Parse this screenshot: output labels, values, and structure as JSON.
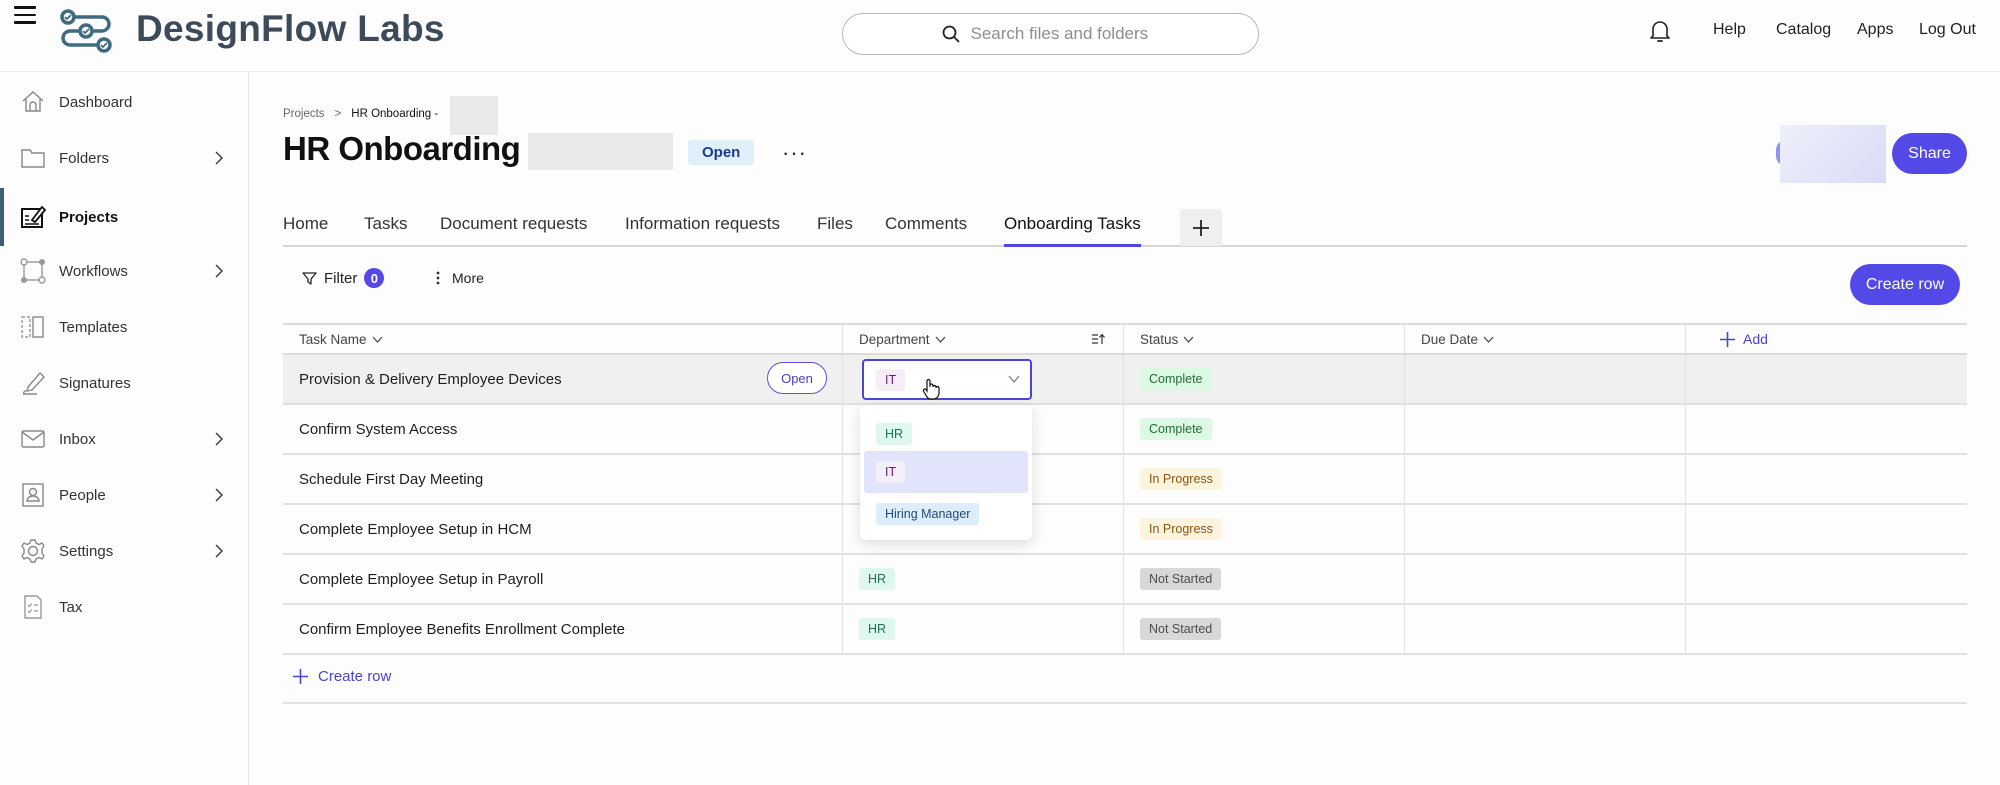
{
  "app": {
    "brand": "DesignFlow Labs",
    "search_placeholder": "Search files and folders",
    "top_links": [
      "Help",
      "Catalog",
      "Apps",
      "Log Out"
    ]
  },
  "sidebar": {
    "items": [
      {
        "label": "Dashboard",
        "icon": "home-icon",
        "has_chevron": false
      },
      {
        "label": "Folders",
        "icon": "folder-icon",
        "has_chevron": true
      },
      {
        "label": "Projects",
        "icon": "projects-icon",
        "has_chevron": false,
        "active": true
      },
      {
        "label": "Workflows",
        "icon": "workflow-icon",
        "has_chevron": true
      },
      {
        "label": "Templates",
        "icon": "template-icon",
        "has_chevron": false
      },
      {
        "label": "Signatures",
        "icon": "pen-icon",
        "has_chevron": false
      },
      {
        "label": "Inbox",
        "icon": "mail-icon",
        "has_chevron": true
      },
      {
        "label": "People",
        "icon": "contact-book-icon",
        "has_chevron": true
      },
      {
        "label": "Settings",
        "icon": "gear-icon",
        "has_chevron": true
      },
      {
        "label": "Tax",
        "icon": "checklist-doc-icon",
        "has_chevron": false
      }
    ]
  },
  "page": {
    "breadcrumb": {
      "root": "Projects",
      "separator": ">",
      "current": "HR Onboarding - "
    },
    "title": "HR Onboarding -",
    "status": "Open",
    "more": "···",
    "share_label": "Share"
  },
  "tabs": [
    {
      "label": "Home"
    },
    {
      "label": "Tasks"
    },
    {
      "label": "Document requests"
    },
    {
      "label": "Information requests"
    },
    {
      "label": "Files"
    },
    {
      "label": "Comments"
    },
    {
      "label": "Onboarding Tasks",
      "active": true
    }
  ],
  "toolbar": {
    "filter_label": "Filter",
    "filter_count": "0",
    "more_label": "More",
    "create_row_label": "Create row"
  },
  "table": {
    "columns": [
      "Task Name",
      "Department",
      "Status",
      "Due Date"
    ],
    "add_column_label": "Add",
    "open_row_label": "Open",
    "rows": [
      {
        "task": "Provision & Delivery Employee Devices",
        "department": "IT",
        "status": "Complete",
        "due_date": ""
      },
      {
        "task": "Confirm System Access",
        "department": "",
        "status": "Complete",
        "due_date": ""
      },
      {
        "task": "Schedule First Day Meeting",
        "department": "",
        "status": "In Progress",
        "due_date": ""
      },
      {
        "task": "Complete Employee Setup in HCM",
        "department": "",
        "status": "In Progress",
        "due_date": ""
      },
      {
        "task": "Complete Employee Setup in Payroll",
        "department": "HR",
        "status": "Not Started",
        "due_date": ""
      },
      {
        "task": "Confirm Employee Benefits Enrollment Complete",
        "department": "HR",
        "status": "Not Started",
        "due_date": ""
      }
    ],
    "create_row_label": "Create row"
  },
  "department_dropdown": {
    "selected": "IT",
    "options": [
      "HR",
      "IT",
      "Hiring Manager"
    ],
    "highlighted": "IT"
  },
  "colors": {
    "accent": "#5349e6",
    "brand_text": "#3d4a5a",
    "status_complete_bg": "#dcf9e3",
    "status_in_progress_bg": "#fdf4dd",
    "status_not_started_bg": "#d8d8d8"
  }
}
